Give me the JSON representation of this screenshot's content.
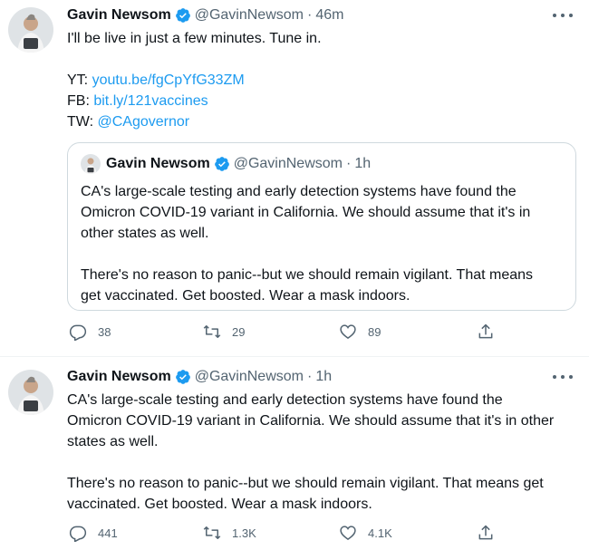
{
  "tweets": [
    {
      "author_name": "Gavin Newsom",
      "handle": "@GavinNewsom",
      "separator": "·",
      "time": "46m",
      "text_intro": "I'll be live in just a few minutes. Tune in.",
      "links": [
        {
          "label": "YT:",
          "value": "youtu.be/fgCpYfG33ZM"
        },
        {
          "label": "FB:",
          "value": "bit.ly/121vaccines"
        },
        {
          "label": "TW:",
          "value": "@CAgovernor"
        }
      ],
      "quoted": {
        "author_name": "Gavin Newsom",
        "handle": "@GavinNewsom",
        "separator": "·",
        "time": "1h",
        "lines": [
          "CA's large-scale testing and early detection systems have found the",
          "Omicron COVID-19 variant in California. We should assume that it's in",
          "other states as well.",
          "",
          "There's no reason to panic--but we should remain vigilant. That means",
          "get vaccinated. Get boosted. Wear a mask indoors."
        ]
      },
      "replies": "38",
      "retweets": "29",
      "likes": "89"
    },
    {
      "author_name": "Gavin Newsom",
      "handle": "@GavinNewsom",
      "separator": "·",
      "time": "1h",
      "lines": [
        "CA's large-scale testing and early detection systems have found the",
        "Omicron COVID-19 variant in California. We should assume that it's in other",
        "states as well.",
        "",
        "There's no reason to panic--but we should remain vigilant. That means get",
        "vaccinated. Get boosted. Wear a mask indoors."
      ],
      "replies": "441",
      "retweets": "1.3K",
      "likes": "4.1K"
    }
  ],
  "icons": {
    "verified": "verified-badge-icon",
    "more": "more-options-icon",
    "reply": "reply-icon",
    "retweet": "retweet-icon",
    "like": "like-icon",
    "share": "share-icon"
  },
  "colors": {
    "link": "#1d9bf0",
    "secondary_text": "#536471",
    "verified": "#1d9bf0",
    "border": "#cfd9de"
  }
}
